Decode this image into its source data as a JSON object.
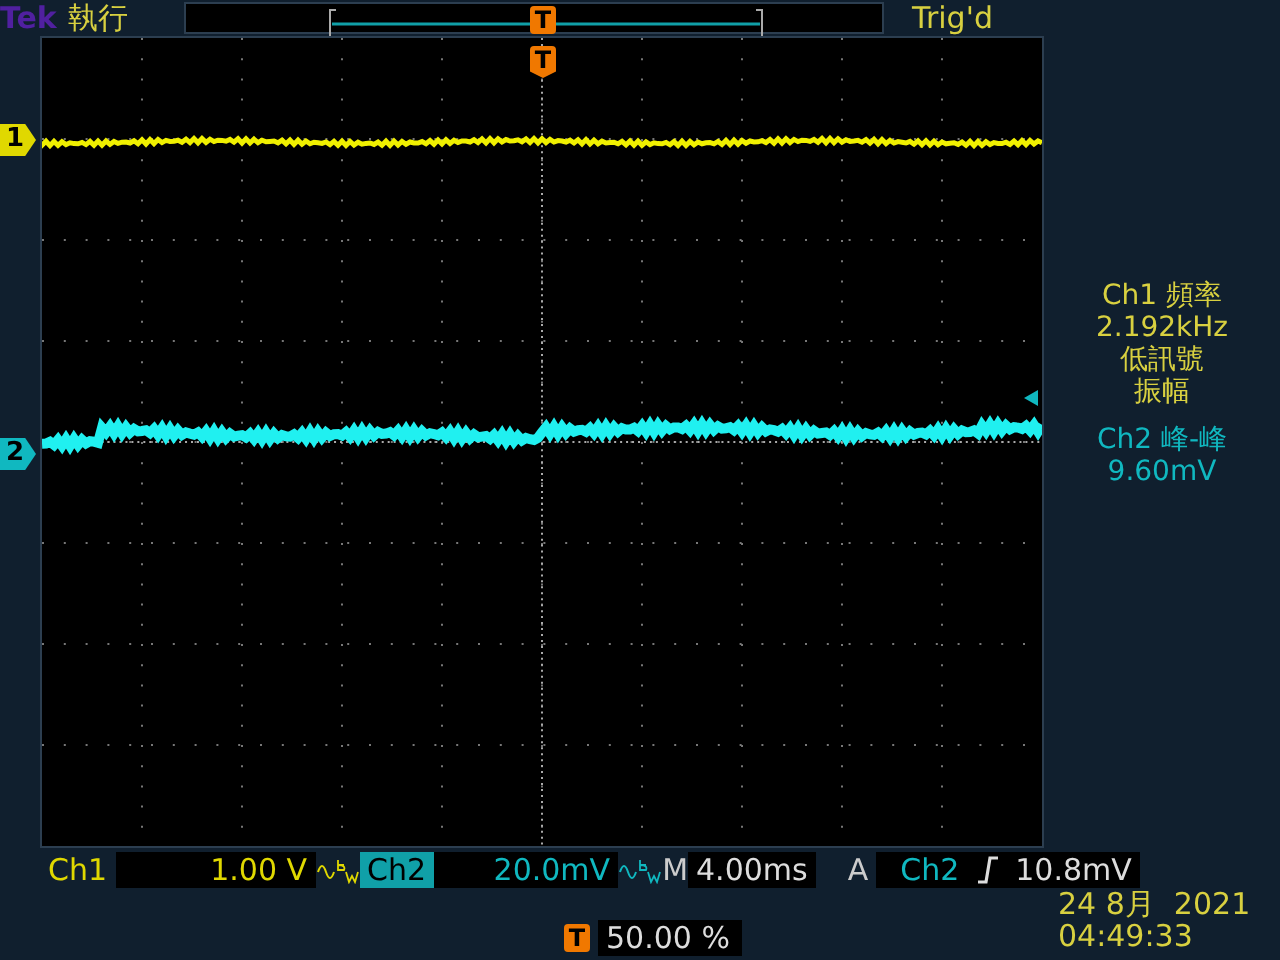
{
  "header": {
    "brand": "Tek",
    "run_state": "執行",
    "trigger_status": "Trig'd",
    "record_marker": "T"
  },
  "screen": {
    "trigger_position_marker": "T",
    "channel_markers": [
      {
        "label": "1",
        "color": "#e0d800"
      },
      {
        "label": "2",
        "color": "#10b8c0"
      }
    ]
  },
  "measurements": [
    {
      "title": "Ch1 頻率",
      "value": "2.192kHz",
      "notes": [
        "低訊號",
        "振幅"
      ],
      "color": "#d8d040"
    },
    {
      "title": "Ch2 峰-峰",
      "value": "9.60mV",
      "color": "#10b8c0"
    }
  ],
  "channel_settings": [
    {
      "label": "Ch1",
      "scale": "1.00 V",
      "bandwidth_limited": true,
      "selected": false
    },
    {
      "label": "Ch2",
      "scale": "20.0mV",
      "bandwidth_limited": true,
      "selected": true
    }
  ],
  "timebase": {
    "label": "M",
    "value": "4.00ms"
  },
  "trigger": {
    "mode": "A",
    "source": "Ch2",
    "rising_edge": true,
    "level": "10.8mV"
  },
  "trigger_position": {
    "icon": "T",
    "value": "50.00 %"
  },
  "date": "24 8月  2021",
  "time": "04:49:33"
}
